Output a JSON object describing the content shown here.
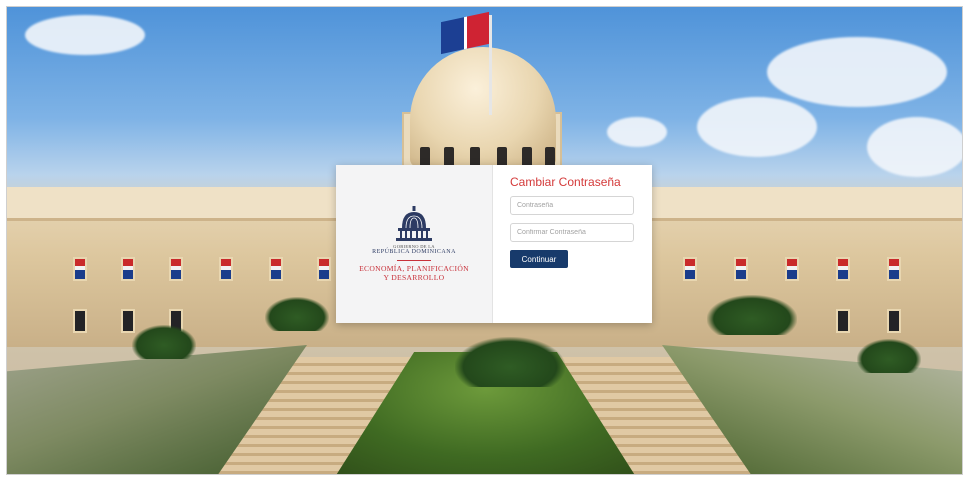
{
  "form": {
    "title": "Cambiar Contraseña",
    "password_placeholder": "Contraseña",
    "confirm_placeholder": "Confirmar Contraseña",
    "continue_label": "Continuar"
  },
  "branding": {
    "gov_line_1": "GOBIERNO DE LA",
    "gov_line_2": "REPÚBLICA DOMINICANA",
    "ministry_line_1": "ECONOMÍA, PLANIFICACIÓN",
    "ministry_line_2": "Y DESARROLLO"
  },
  "colors": {
    "title_red": "#d43a3a",
    "button_navy": "#173a6b",
    "ministry_red": "#c8313a",
    "logo_navy": "#2d3b63"
  },
  "icons": {
    "logo": "national-palace-dome-logo"
  }
}
